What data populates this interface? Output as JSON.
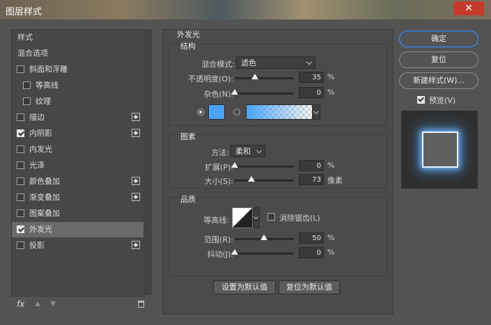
{
  "window": {
    "title": "图层样式",
    "close_glyph": "✕"
  },
  "left": {
    "items": [
      {
        "label": "样式",
        "checkbox": false,
        "checked": false,
        "plus": false,
        "selected": false
      },
      {
        "label": "混合选项",
        "checkbox": false,
        "checked": false,
        "plus": false,
        "selected": false
      },
      {
        "label": "斜面和浮雕",
        "checkbox": true,
        "checked": false,
        "plus": false,
        "selected": false
      },
      {
        "label": "等高线",
        "checkbox": true,
        "checked": false,
        "plus": false,
        "selected": false
      },
      {
        "label": "纹理",
        "checkbox": true,
        "checked": false,
        "plus": false,
        "selected": false
      },
      {
        "label": "描边",
        "checkbox": true,
        "checked": false,
        "plus": true,
        "selected": false
      },
      {
        "label": "内阴影",
        "checkbox": true,
        "checked": true,
        "plus": true,
        "selected": false
      },
      {
        "label": "内发光",
        "checkbox": true,
        "checked": false,
        "plus": false,
        "selected": false
      },
      {
        "label": "光泽",
        "checkbox": true,
        "checked": false,
        "plus": false,
        "selected": false
      },
      {
        "label": "颜色叠加",
        "checkbox": true,
        "checked": false,
        "plus": true,
        "selected": false
      },
      {
        "label": "渐变叠加",
        "checkbox": true,
        "checked": false,
        "plus": true,
        "selected": false
      },
      {
        "label": "图案叠加",
        "checkbox": true,
        "checked": false,
        "plus": false,
        "selected": false
      },
      {
        "label": "外发光",
        "checkbox": true,
        "checked": true,
        "plus": false,
        "selected": true
      },
      {
        "label": "投影",
        "checkbox": true,
        "checked": false,
        "plus": true,
        "selected": false
      }
    ],
    "footer": {
      "fx": "fx"
    }
  },
  "panel": {
    "title": "外发光",
    "structure": {
      "title": "结构",
      "blend_mode_label": "混合模式:",
      "blend_mode_value": "滤色",
      "opacity_label": "不透明度(O):",
      "opacity_value": "35",
      "opacity_level": 35,
      "noise_label": "杂色(N):",
      "noise_value": "0",
      "noise_level": 0,
      "unit_percent": "%",
      "color": "#4aa3f7",
      "gradient_start": "#4aa3f7"
    },
    "elements": {
      "title": "图素",
      "method_label": "方法:",
      "method_value": "柔和",
      "spread_label": "扩展(P):",
      "spread_value": "0",
      "spread_level": 0,
      "size_label": "大小(S):",
      "size_value": "73",
      "size_level": 0.29,
      "unit_percent": "%",
      "unit_px": "像素"
    },
    "quality": {
      "title": "品质",
      "contour_label": "等高线:",
      "antialias_label": "消除锯齿(L)",
      "range_label": "范围(R):",
      "range_value": "50",
      "range_level": 50,
      "jitter_label": "抖动(J):",
      "jitter_value": "0",
      "jitter_level": 0,
      "unit_percent": "%"
    },
    "buttons": {
      "make_default": "设置为默认值",
      "reset_default": "复位为默认值"
    }
  },
  "right": {
    "ok": "确定",
    "reset": "复位",
    "new_style": "新建样式(W)...",
    "preview_label": "预览(V)",
    "preview_checked": true
  }
}
